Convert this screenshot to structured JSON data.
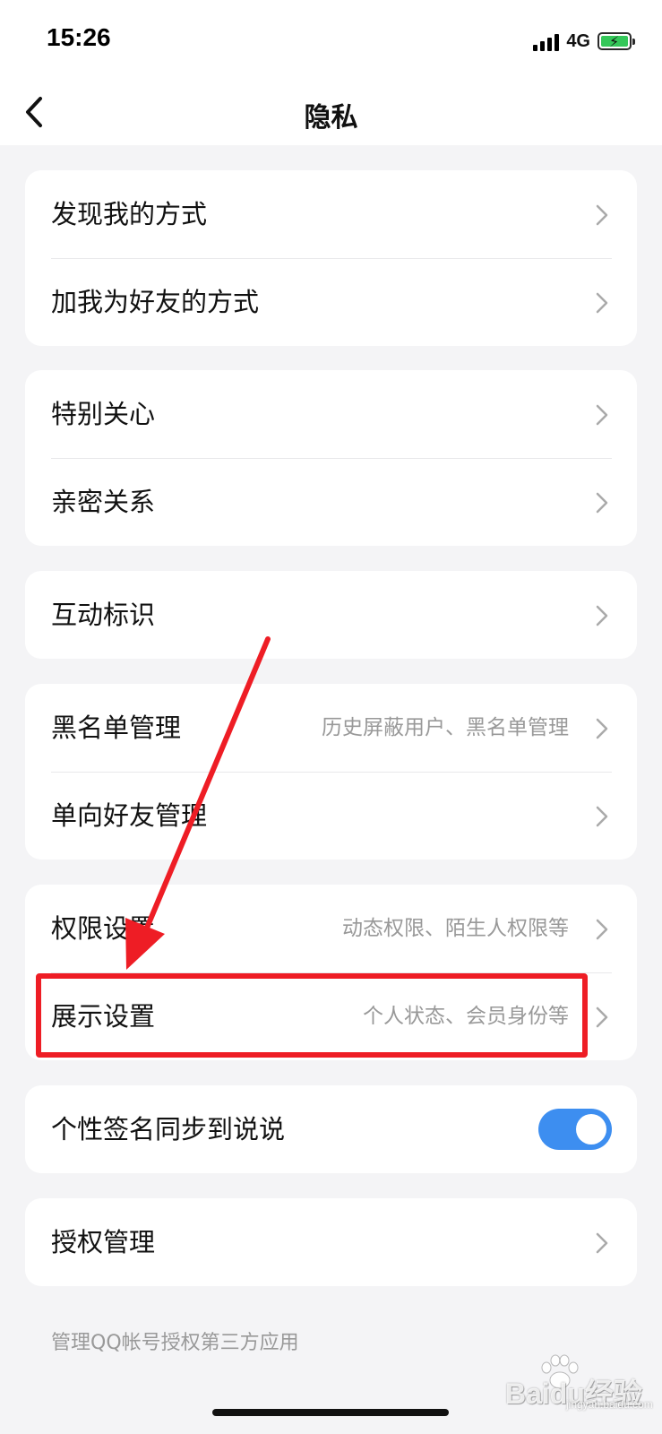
{
  "status_bar": {
    "time": "15:26",
    "network": "4G"
  },
  "header": {
    "title": "隐私",
    "back_icon": "chevron-left-icon"
  },
  "groups": [
    {
      "rows": [
        {
          "label": "发现我的方式",
          "sub": ""
        },
        {
          "label": "加我为好友的方式",
          "sub": ""
        }
      ]
    },
    {
      "rows": [
        {
          "label": "特别关心",
          "sub": ""
        },
        {
          "label": "亲密关系",
          "sub": ""
        }
      ]
    },
    {
      "rows": [
        {
          "label": "互动标识",
          "sub": ""
        }
      ]
    },
    {
      "rows": [
        {
          "label": "黑名单管理",
          "sub": "历史屏蔽用户、黑名单管理"
        },
        {
          "label": "单向好友管理",
          "sub": ""
        }
      ]
    },
    {
      "rows": [
        {
          "label": "权限设置",
          "sub": "动态权限、陌生人权限等"
        },
        {
          "label": "展示设置",
          "sub": "个人状态、会员身份等"
        }
      ]
    },
    {
      "rows": [
        {
          "label": "个性签名同步到说说",
          "toggle_on": true
        }
      ]
    },
    {
      "rows": [
        {
          "label": "授权管理",
          "sub": ""
        }
      ]
    }
  ],
  "footnote": "管理QQ帐号授权第三方应用",
  "annotation": {
    "highlight_color": "#ee1d25",
    "arrow_color": "#ee1d25"
  },
  "colors": {
    "toggle_on": "#3d8ef0",
    "background": "#f4f4f6"
  },
  "watermark": {
    "text": "Baidu经验",
    "sub": "jingyan.baidu.com"
  }
}
